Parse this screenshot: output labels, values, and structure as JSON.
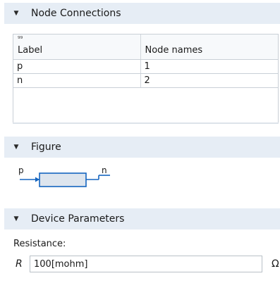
{
  "sections": {
    "node_connections": {
      "title": "Node Connections"
    },
    "figure": {
      "title": "Figure"
    },
    "device_parameters": {
      "title": "Device Parameters"
    }
  },
  "table": {
    "sort_marker": "⁹⁹",
    "headers": [
      "Label",
      "Node names"
    ],
    "rows": [
      {
        "label": "p",
        "node": "1"
      },
      {
        "label": "n",
        "node": "2"
      }
    ]
  },
  "figure": {
    "left_terminal": "p",
    "right_terminal": "n",
    "colors": {
      "stroke": "#1565c0",
      "fill": "#dde5ee"
    }
  },
  "device_parameters": {
    "resistance_label": "Resistance:",
    "symbol": "R",
    "value": "100[mohm]",
    "unit": "Ω"
  },
  "colors": {
    "header_bg": "#e6edf5",
    "accent": "#1565c0"
  }
}
